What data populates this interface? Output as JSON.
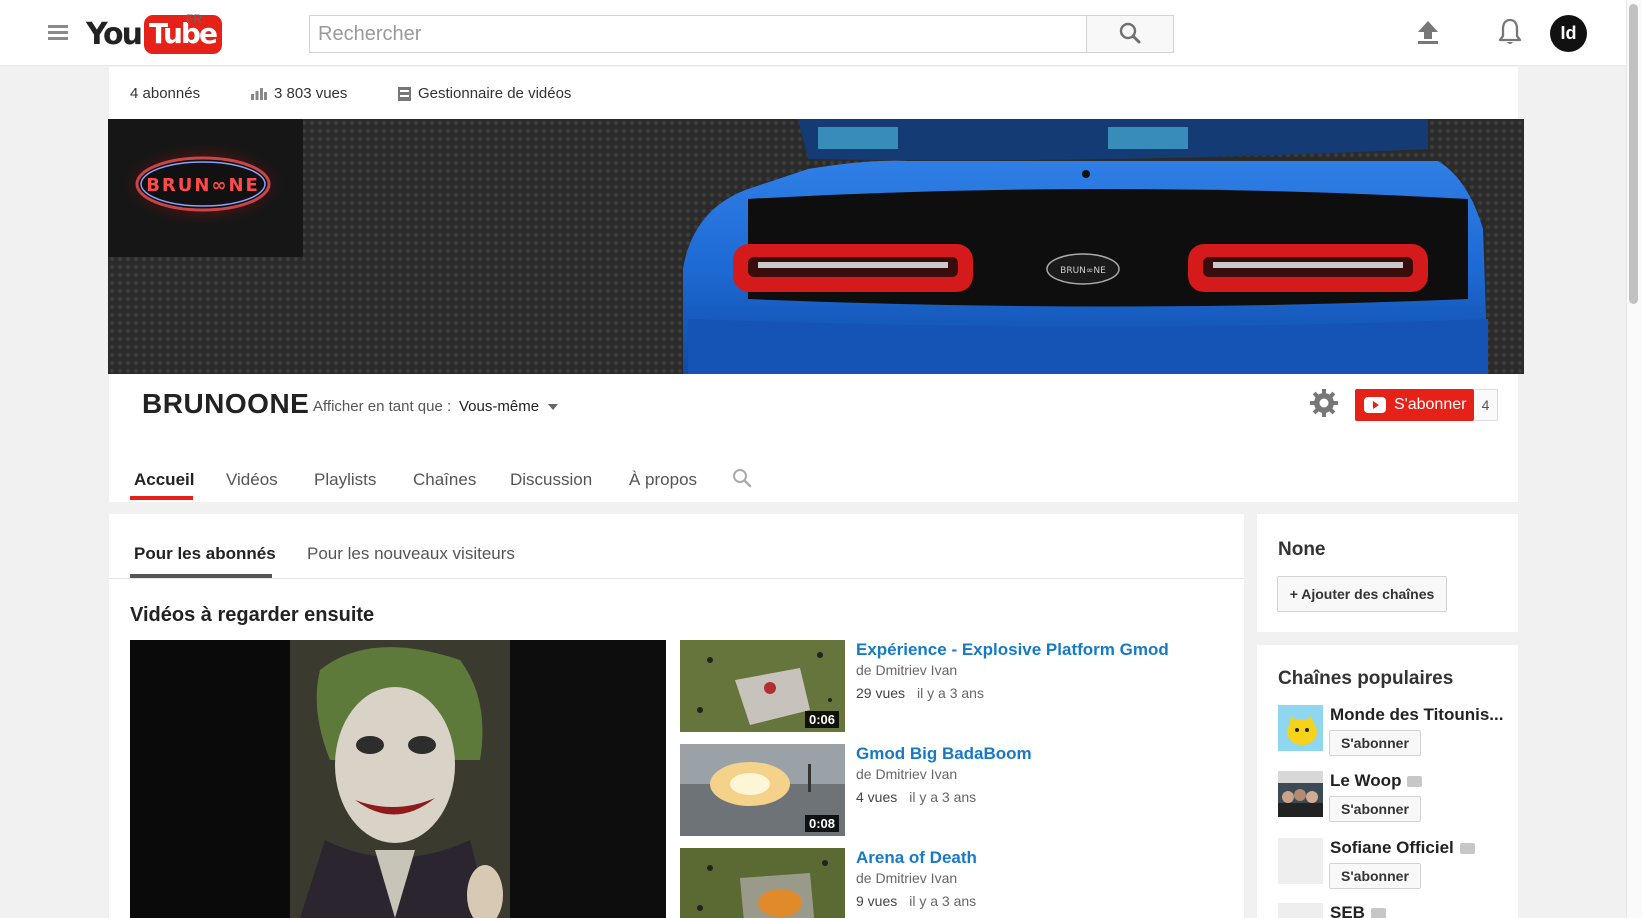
{
  "topbar": {
    "logo_you": "You",
    "logo_tube": "Tube",
    "region": "FR",
    "search_placeholder": "Rechercher"
  },
  "channel": {
    "stats": {
      "subscribers": "4 abonnés",
      "views": "3 803 vues",
      "video_manager": "Gestionnaire de vidéos"
    },
    "name": "BRUNOONE",
    "view_as_label": "Afficher en tant que :",
    "view_as_value": "Vous-même",
    "subscribe_label": "S'abonner",
    "subscribe_count": "4",
    "tabs": [
      "Accueil",
      "Vidéos",
      "Playlists",
      "Chaînes",
      "Discussion",
      "À propos"
    ]
  },
  "main": {
    "subtabs": [
      "Pour les abonnés",
      "Pour les nouveaux visiteurs"
    ],
    "section_title": "Vidéos à regarder ensuite",
    "videos": [
      {
        "title": "Expérience - Explosive Platform Gmod",
        "author": "de Dmitriev Ivan",
        "views": "29 vues",
        "age": "il y a 3 ans",
        "duration": "0:06"
      },
      {
        "title": "Gmod Big BadaBoom",
        "author": "de Dmitriev Ivan",
        "views": "4 vues",
        "age": "il y a 3 ans",
        "duration": "0:08"
      },
      {
        "title": "Arena of Death",
        "author": "de Dmitriev Ivan",
        "views": "9 vues",
        "age": "il y a 3 ans",
        "duration": ""
      }
    ]
  },
  "sidebar": {
    "card1_title": "None",
    "add_channels_label": "+ Ajouter des chaînes",
    "popular_title": "Chaînes populaires",
    "popular": [
      {
        "name": "Monde des Titounis...",
        "subscribe": "S'abonner"
      },
      {
        "name": "Le Woop",
        "subscribe": "S'abonner"
      },
      {
        "name": "Sofiane Officiel",
        "subscribe": "S'abonner"
      },
      {
        "name": "SEB",
        "subscribe": ""
      }
    ]
  },
  "colors": {
    "accent": "#e62117",
    "link": "#167ac6"
  }
}
